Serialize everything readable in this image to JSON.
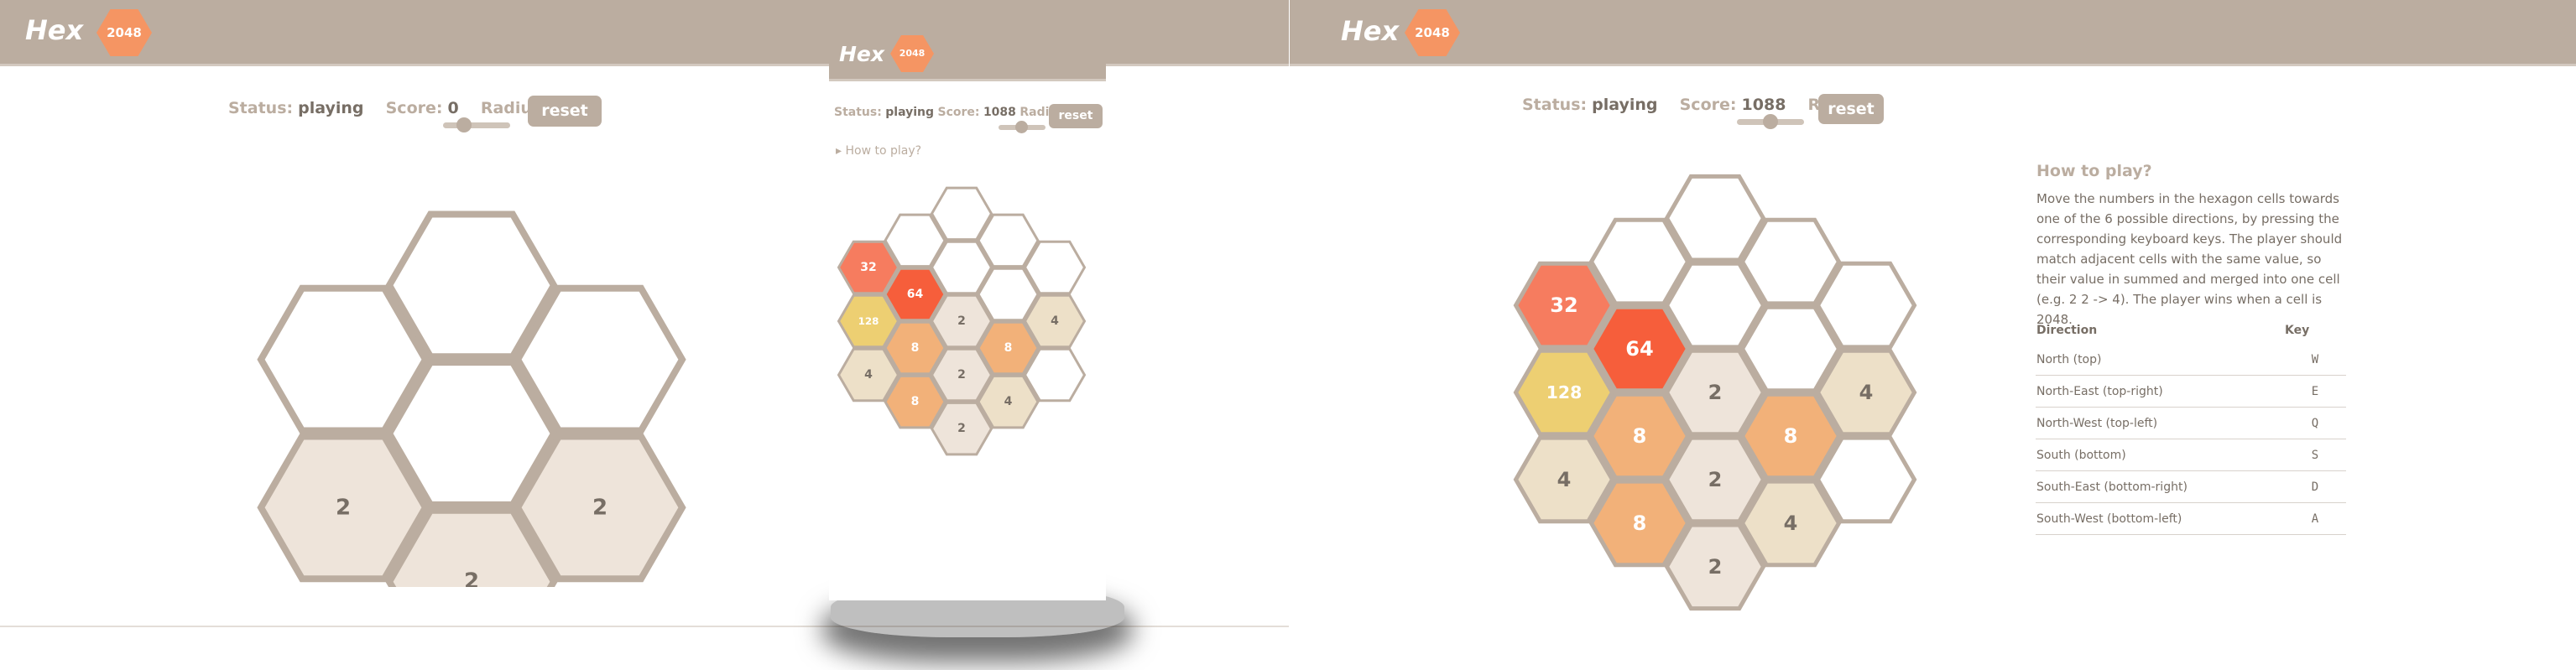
{
  "colors": {
    "header": "#bbada0",
    "badge": "#f59563",
    "tile_2": "#eee4da",
    "tile_4": "#ede0c8",
    "tile_8": "#f2b179",
    "tile_32": "#f67c5f",
    "tile_64": "#f65e3b",
    "tile_128": "#edcf72",
    "hex_border": "#bbada0"
  },
  "app": {
    "title": "Hex",
    "badge": "2048"
  },
  "labels": {
    "status": "Status:",
    "score": "Score:",
    "radius": "Radius",
    "reset": "reset",
    "how_to_toggle": "How to play?",
    "how_to_title": "How to play?",
    "how_to_text": "Move the numbers in the hexagon cells towards one of the 6 possible directions, by pressing the corresponding keyboard keys. The player should match adjacent cells with the same value, so their value in summed and merged into one cell (e.g. 2 2 -> 4). The player wins when a cell is 2048.",
    "col_direction": "Direction",
    "col_key": "Key"
  },
  "directions": [
    {
      "direction": "North (top)",
      "key": "W"
    },
    {
      "direction": "North-East (top-right)",
      "key": "E"
    },
    {
      "direction": "North-West (top-left)",
      "key": "Q"
    },
    {
      "direction": "South (bottom)",
      "key": "S"
    },
    {
      "direction": "South-East (bottom-right)",
      "key": "D"
    },
    {
      "direction": "South-West (bottom-left)",
      "key": "A"
    }
  ],
  "panel_left": {
    "status": "playing",
    "score": "0",
    "radius": "2",
    "radius_fraction": 0.25
  },
  "panel_mid": {
    "status": "playing",
    "score": "1088",
    "radius": "3",
    "radius_fraction": 0.5
  },
  "panel_right": {
    "status": "playing",
    "score": "1088",
    "radius": "3",
    "radius_fraction": 0.5
  },
  "board_small": [
    {
      "q": 0,
      "r": -1,
      "v": null
    },
    {
      "q": -1,
      "r": 0,
      "v": null
    },
    {
      "q": 1,
      "r": -1,
      "v": null
    },
    {
      "q": 0,
      "r": 0,
      "v": null
    },
    {
      "q": -1,
      "r": 1,
      "v": 2
    },
    {
      "q": 1,
      "r": 0,
      "v": 2
    },
    {
      "q": 0,
      "r": 1,
      "v": 2
    }
  ],
  "board_large": [
    {
      "q": 0,
      "r": -2,
      "v": null
    },
    {
      "q": -1,
      "r": -1,
      "v": null
    },
    {
      "q": 1,
      "r": -2,
      "v": null
    },
    {
      "q": -2,
      "r": 0,
      "v": 32
    },
    {
      "q": 0,
      "r": -1,
      "v": null
    },
    {
      "q": 2,
      "r": -2,
      "v": null
    },
    {
      "q": -1,
      "r": 0,
      "v": 64
    },
    {
      "q": 1,
      "r": -1,
      "v": null
    },
    {
      "q": -2,
      "r": 1,
      "v": 128
    },
    {
      "q": 0,
      "r": 0,
      "v": 2
    },
    {
      "q": 2,
      "r": -1,
      "v": 4
    },
    {
      "q": -1,
      "r": 1,
      "v": 8
    },
    {
      "q": 1,
      "r": 0,
      "v": 8
    },
    {
      "q": -2,
      "r": 2,
      "v": 4
    },
    {
      "q": 0,
      "r": 1,
      "v": 2
    },
    {
      "q": 2,
      "r": 0,
      "v": null
    },
    {
      "q": -1,
      "r": 2,
      "v": 8
    },
    {
      "q": 1,
      "r": 1,
      "v": 4
    },
    {
      "q": 0,
      "r": 2,
      "v": 2
    }
  ]
}
